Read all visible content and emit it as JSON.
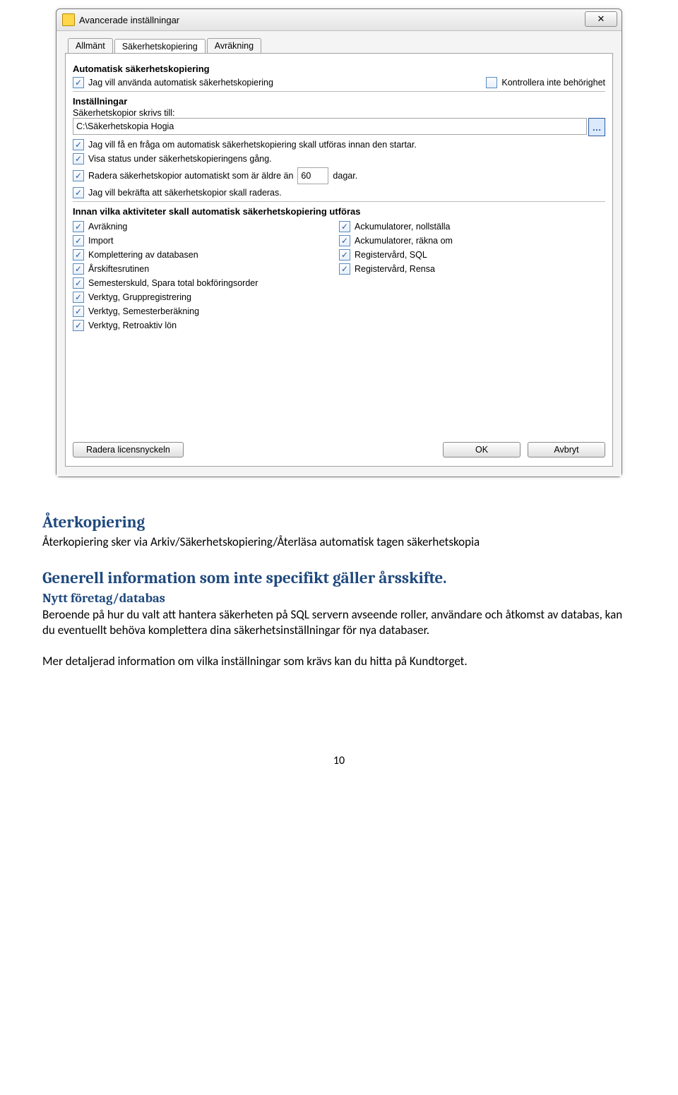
{
  "window": {
    "title": "Avancerade inställningar",
    "close_glyph": "✕"
  },
  "tabs": [
    "Allmänt",
    "Säkerhetskopiering",
    "Avräkning"
  ],
  "group_auto": {
    "title": "Automatisk säkerhetskopiering",
    "use_auto_label": "Jag vill använda automatisk säkerhetskopiering",
    "no_perm_check_label": "Kontrollera inte behörighet"
  },
  "group_settings": {
    "title": "Inställningar",
    "path_label": "Säkerhetskopior skrivs till:",
    "path_value": "C:\\Säkerhetskopia Hogia",
    "browse_glyph": "…",
    "ask_before_label": "Jag vill få en fråga om automatisk säkerhetskopiering skall utföras innan den startar.",
    "show_status_label": "Visa status under säkerhetskopieringens gång.",
    "delete_old_prefix": "Radera säkerhetskopior automatiskt som är äldre än",
    "delete_old_days": "60",
    "delete_old_suffix": "dagar.",
    "confirm_delete_label": "Jag vill bekräfta att säkerhetskopior skall raderas."
  },
  "group_activities": {
    "title": "Innan vilka aktiviteter skall automatisk säkerhetskopiering utföras",
    "left": [
      "Avräkning",
      "Import",
      "Komplettering av databasen",
      "Årskiftesrutinen",
      "Semesterskuld, Spara total bokföringsorder",
      "Verktyg, Gruppregistrering",
      "Verktyg, Semesterberäkning",
      "Verktyg, Retroaktiv lön"
    ],
    "right": [
      "Ackumulatorer, nollställa",
      "Ackumulatorer, räkna om",
      "Registervård, SQL",
      "Registervård, Rensa"
    ]
  },
  "buttons": {
    "delete_license": "Radera licensnyckeln",
    "ok": "OK",
    "cancel": "Avbryt"
  },
  "document": {
    "h_restore": "Återkopiering",
    "p_restore": "Återkopiering sker via Arkiv/Säkerhetskopiering/Återläsa automatisk tagen säkerhetskopia",
    "h_general": "Generell information som inte specifikt gäller årsskifte.",
    "sub_newdb": "Nytt företag/databas",
    "p_newdb": "Beroende på hur du valt att hantera säkerheten på SQL servern avseende roller, användare och åtkomst av databas, kan du eventuellt behöva komplettera dina säkerhetsinställningar för nya databaser.",
    "p_more": "Mer detaljerad information om vilka inställningar som krävs kan du hitta på Kundtorget.",
    "page_number": "10"
  }
}
